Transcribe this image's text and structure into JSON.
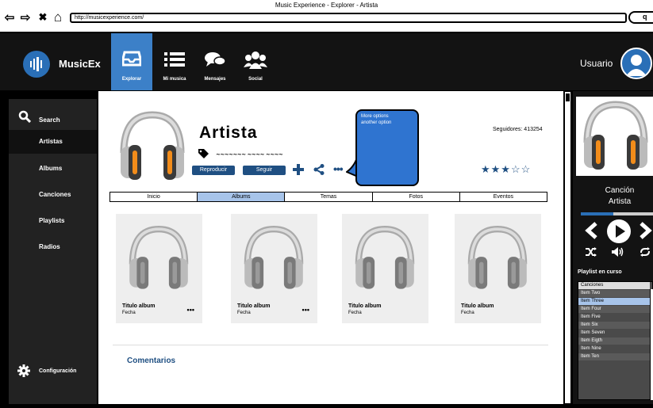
{
  "window": {
    "title": "Music Experience - Explorer - Artista",
    "url": "http://musicexperience.com/",
    "back_glyph": "⇦",
    "forward_glyph": "⇨",
    "stop_glyph": "✖",
    "home_glyph": "⌂",
    "search_glyph": "q"
  },
  "app": {
    "name": "MusicEx",
    "nav": [
      {
        "label": "Explorar",
        "icon": "inbox-icon",
        "active": true
      },
      {
        "label": "Mi musica",
        "icon": "list-icon"
      },
      {
        "label": "Mensajes",
        "icon": "chat-icon"
      },
      {
        "label": "Social",
        "icon": "group-icon"
      }
    ],
    "user_label": "Usuario"
  },
  "sidebar": {
    "items": [
      {
        "label": "Search",
        "icon": "search-icon"
      },
      {
        "label": "Artistas",
        "active": true
      },
      {
        "label": "Albums"
      },
      {
        "label": "Canciones"
      },
      {
        "label": "Playlists"
      },
      {
        "label": "Radios"
      }
    ],
    "settings_label": "Configuración"
  },
  "artist": {
    "name": "Artista",
    "tags": "~~~~~~~ ~~~~ ~~~~",
    "play_label": "Reproducir",
    "follow_label": "Seguir",
    "followers": "Seguidores: 413254",
    "rating_stars": "★★★☆☆",
    "rating": 3,
    "rating_max": 5,
    "more_glyph": "•••",
    "bubble_text": "More options\nanother option"
  },
  "tabs": [
    {
      "label": "Inicio"
    },
    {
      "label": "Albums",
      "active": true
    },
    {
      "label": "Temas"
    },
    {
      "label": "Fotos"
    },
    {
      "label": "Eventos"
    }
  ],
  "albums": [
    {
      "title": "Titulo album",
      "date": "Fecha",
      "menu": "•••"
    },
    {
      "title": "Titulo album",
      "date": "Fecha",
      "menu": "•••"
    },
    {
      "title": "Titulo album",
      "date": "Fecha",
      "menu": ""
    },
    {
      "title": "Titulo album",
      "date": "Fecha",
      "menu": ""
    }
  ],
  "comments_label": "Comentarios",
  "player": {
    "song": "Canción",
    "artist": "Artista",
    "progress": 0.45,
    "playlist_label": "Playlist en curso",
    "playlist_header": "Canciones",
    "playlist": [
      "Item Two",
      "Item Three",
      "Item Four",
      "Item Five",
      "Item Six",
      "Item Seven",
      "Item Eigth",
      "Item Nine",
      "Item Ten"
    ],
    "selected_index": 1
  },
  "colors": {
    "accent": "#2a6fb7",
    "dark_button": "#1f4f82",
    "active_tab": "#a7c4ea",
    "topbar": "#131313"
  }
}
